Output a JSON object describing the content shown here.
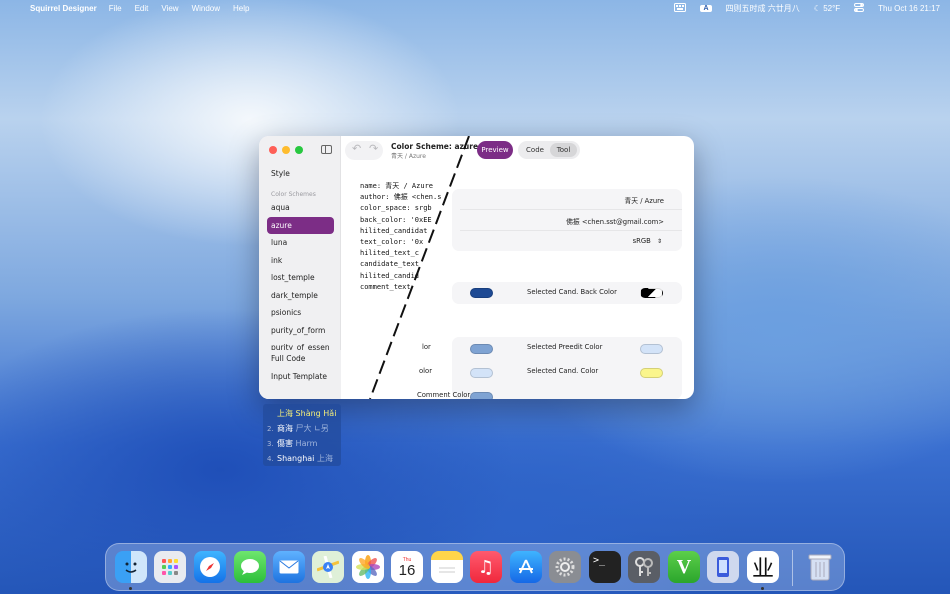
{
  "menubar": {
    "app_name": "Squirrel Designer",
    "menus": [
      "File",
      "Edit",
      "View",
      "Window",
      "Help"
    ],
    "input_badge": "A",
    "lunar_date": "四则五时成 六廿月八",
    "weather": "52°F",
    "clock": "Thu Oct 16  21:17"
  },
  "sidebar": {
    "style_label": "Style",
    "section_label": "Color Schemes",
    "schemes": [
      "aqua",
      "azure",
      "luna",
      "ink",
      "lost_temple",
      "dark_temple",
      "psionics",
      "purity_of_form",
      "purity_of_essen"
    ],
    "active_scheme": "azure",
    "full_code": "Full Code",
    "input_template": "Input Template"
  },
  "toolbar": {
    "undo": "↶",
    "redo": "↷",
    "title": "Color Scheme: azure",
    "subtitle": "青天 / Azure",
    "preview": "Preview",
    "code": "Code",
    "tool": "Tool"
  },
  "code_lines": [
    "name: 青天 / Azure",
    "author: 佛振 <chen.s",
    "color_space: srgb",
    "back_color: '0xEE",
    "hilited_candidat",
    "text_color: '0x",
    "hilited_text_c",
    "candidate_text",
    "hilited_candid",
    "comment_text"
  ],
  "meta": {
    "name_value": "青天 / Azure",
    "author_value": "佛振 <chen.sst@gmail.com>",
    "color_space_value": "sRGB"
  },
  "colors": {
    "selected_back_label": "Selected Cand. Back Color",
    "row1_left_label": "lor",
    "selected_preedit_label": "Selected Preedit Color",
    "row2_left_label": "olor",
    "selected_cand_label": "Selected Cand. Color",
    "comment_label": "Comment Color",
    "dark_blue": "#1e4a94",
    "mid_blue": "#7fa3d3",
    "light_blue": "#d3e3f8",
    "yellow": "#faf58c"
  },
  "candidates": [
    {
      "index": "",
      "text": "上海",
      "comment": "Shàng Hǎi",
      "highlighted": true
    },
    {
      "index": "2.",
      "text": "商海",
      "comment": "尸大 ∟另",
      "highlighted": false
    },
    {
      "index": "3.",
      "text": "傷害",
      "comment": "Harm",
      "highlighted": false
    },
    {
      "index": "4.",
      "text": "Shanghai",
      "comment": "上海",
      "highlighted": false
    }
  ],
  "dock": {
    "calendar_month": "Thu",
    "calendar_day": "16",
    "terminal_prompt": ">_",
    "squirrel_glyph": "业"
  }
}
